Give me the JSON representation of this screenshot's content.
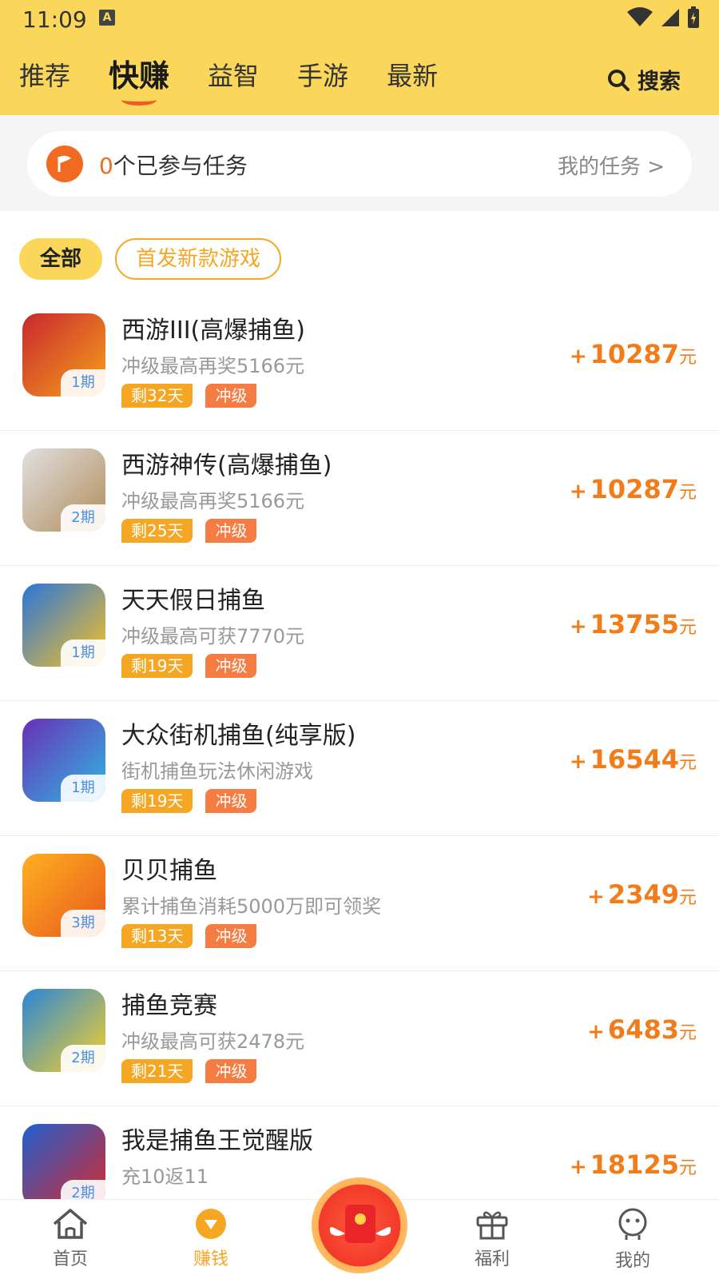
{
  "status": {
    "time": "11:09"
  },
  "header": {
    "tabs": [
      {
        "label": "推荐"
      },
      {
        "label": "快赚"
      },
      {
        "label": "益智"
      },
      {
        "label": "手游"
      },
      {
        "label": "最新"
      }
    ],
    "active_tab": "快赚",
    "search_label": "搜索"
  },
  "task_bar": {
    "count": "0",
    "text": "个已参与任务",
    "link": "我的任务 >"
  },
  "filters": {
    "all": "全部",
    "new": "首发新款游戏"
  },
  "games": [
    {
      "name": "西游III(高爆捕鱼)",
      "desc": "冲级最高再奖5166元",
      "days": "剩32天",
      "tag": "冲级",
      "period": "1期",
      "plus": "+",
      "amount": "10287",
      "unit": "元",
      "colors": [
        "#c8282d",
        "#f7a11c"
      ]
    },
    {
      "name": "西游神传(高爆捕鱼)",
      "desc": "冲级最高再奖5166元",
      "days": "剩25天",
      "tag": "冲级",
      "period": "2期",
      "plus": "+",
      "amount": "10287",
      "unit": "元",
      "colors": [
        "#e0e0e0",
        "#b18c5a"
      ]
    },
    {
      "name": "天天假日捕鱼",
      "desc": "冲级最高可获7770元",
      "days": "剩19天",
      "tag": "冲级",
      "period": "1期",
      "plus": "+",
      "amount": "13755",
      "unit": "元",
      "colors": [
        "#2a76d8",
        "#f9c126"
      ]
    },
    {
      "name": "大众街机捕鱼(纯享版)",
      "desc": "街机捕鱼玩法休闲游戏",
      "days": "剩19天",
      "tag": "冲级",
      "period": "1期",
      "plus": "+",
      "amount": "16544",
      "unit": "元",
      "colors": [
        "#6a2fb8",
        "#2fb8e0"
      ]
    },
    {
      "name": "贝贝捕鱼",
      "desc": "累计捕鱼消耗5000万即可领奖",
      "days": "剩13天",
      "tag": "冲级",
      "period": "3期",
      "plus": "+",
      "amount": "2349",
      "unit": "元",
      "colors": [
        "#ffb020",
        "#e8581c"
      ]
    },
    {
      "name": "捕鱼竞赛",
      "desc": "冲级最高可获2478元",
      "days": "剩21天",
      "tag": "冲级",
      "period": "2期",
      "plus": "+",
      "amount": "6483",
      "unit": "元",
      "colors": [
        "#2a86d8",
        "#f9d126"
      ]
    },
    {
      "name": "我是捕鱼王觉醒版",
      "desc": "充10返11",
      "days": "",
      "tag": "",
      "period": "2期",
      "plus": "+",
      "amount": "18125",
      "unit": "元",
      "colors": [
        "#1f5fd0",
        "#d82a2a"
      ]
    }
  ],
  "bottom_nav": [
    {
      "label": "首页",
      "icon": "home-icon"
    },
    {
      "label": "赚钱",
      "icon": "coin-icon"
    },
    {
      "label": "",
      "icon": "red-packet-icon"
    },
    {
      "label": "福利",
      "icon": "gift-icon"
    },
    {
      "label": "我的",
      "icon": "profile-icon"
    }
  ],
  "colors": {
    "accent_yellow": "#fad75a",
    "accent_orange": "#f27c1a"
  }
}
